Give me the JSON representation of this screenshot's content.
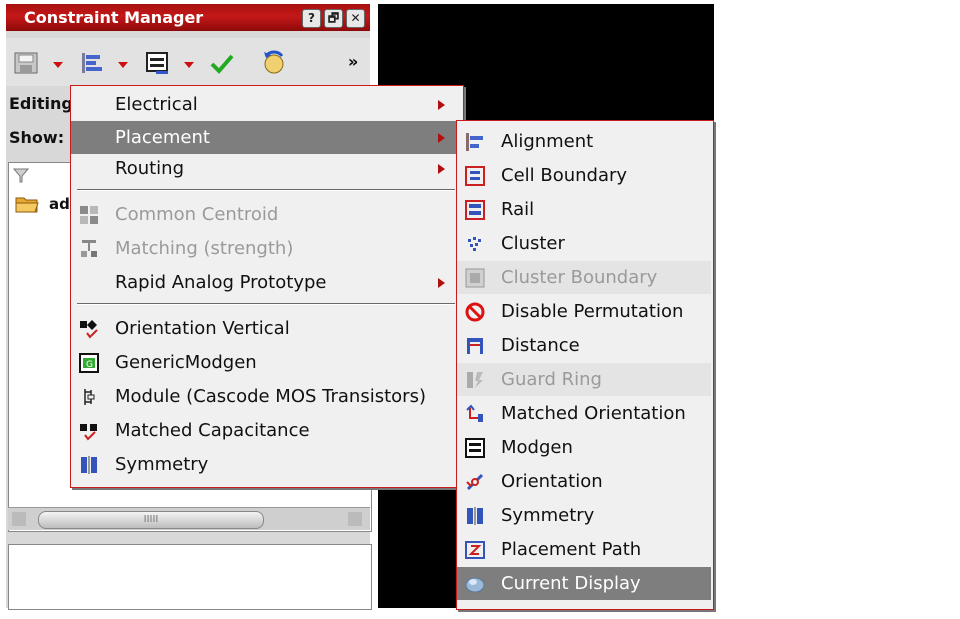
{
  "window": {
    "title": "Constraint Manager",
    "title_buttons": [
      "?",
      "🗗",
      "✕"
    ]
  },
  "toolbar": {
    "overflow": "»"
  },
  "panel": {
    "editing_label": "Editing",
    "show_label": "Show:",
    "tree_item": "ad",
    "scroll_grip": "IIIII"
  },
  "menu": {
    "items": [
      {
        "label": "Electrical",
        "submenu": true
      },
      {
        "label": "Placement",
        "submenu": true,
        "selected": true
      },
      {
        "label": "Routing",
        "submenu": true
      },
      {
        "label": "Common Centroid",
        "disabled": true,
        "icon": "common-centroid-icon"
      },
      {
        "label": "Matching (strength)",
        "disabled": true,
        "icon": "matching-icon"
      },
      {
        "label": "Rapid Analog Prototype",
        "submenu": true
      },
      {
        "label": "Orientation Vertical",
        "icon": "orientation-vertical-icon"
      },
      {
        "label": "GenericModgen",
        "icon": "generic-modgen-icon"
      },
      {
        "label": "Module (Cascode MOS Transistors)",
        "icon": "module-icon"
      },
      {
        "label": "Matched Capacitance",
        "icon": "matched-capacitance-icon"
      },
      {
        "label": "Symmetry",
        "icon": "symmetry-icon"
      }
    ]
  },
  "submenu": {
    "items": [
      {
        "label": "Alignment",
        "icon": "alignment-icon"
      },
      {
        "label": "Cell Boundary",
        "icon": "cell-boundary-icon"
      },
      {
        "label": "Rail",
        "icon": "rail-icon"
      },
      {
        "label": "Cluster",
        "icon": "cluster-icon"
      },
      {
        "label": "Cluster Boundary",
        "disabled": true,
        "icon": "cluster-boundary-icon"
      },
      {
        "label": "Disable Permutation",
        "icon": "disable-permutation-icon"
      },
      {
        "label": "Distance",
        "icon": "distance-icon"
      },
      {
        "label": "Guard Ring",
        "disabled": true,
        "icon": "guard-ring-icon"
      },
      {
        "label": "Matched Orientation",
        "icon": "matched-orientation-icon"
      },
      {
        "label": "Modgen",
        "icon": "modgen-icon"
      },
      {
        "label": "Orientation",
        "icon": "orientation-icon"
      },
      {
        "label": "Symmetry",
        "icon": "symmetry-icon"
      },
      {
        "label": "Placement Path",
        "icon": "placement-path-icon"
      },
      {
        "label": "Current Display",
        "selected": true,
        "icon": "current-display-icon"
      }
    ]
  }
}
